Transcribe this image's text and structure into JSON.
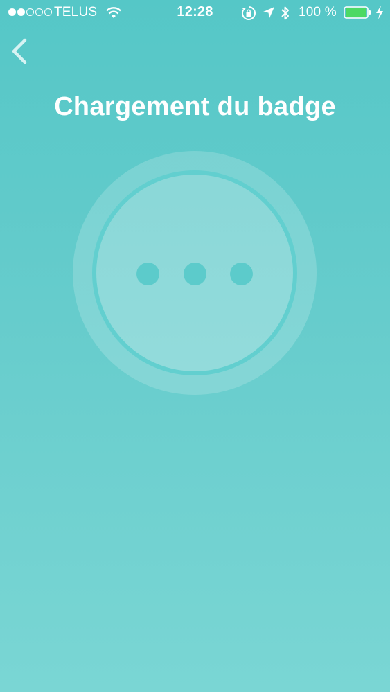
{
  "status_bar": {
    "carrier": "TELUS",
    "time": "12:28",
    "battery_percent": "100 %",
    "signal_bars_filled": 2,
    "signal_bars_total": 5,
    "battery_level": 1.0
  },
  "header": {
    "title": "Chargement du badge"
  },
  "colors": {
    "background_top": "#55c7c7",
    "background_bottom": "#7ad6d4",
    "battery_fill": "#4cd964",
    "text": "#ffffff"
  },
  "icons": {
    "back": "chevron-left-icon",
    "wifi": "wifi-icon",
    "rotation_lock": "rotation-lock-icon",
    "location": "location-arrow-icon",
    "bluetooth": "bluetooth-icon",
    "battery": "battery-icon",
    "charging": "lightning-bolt-icon"
  }
}
